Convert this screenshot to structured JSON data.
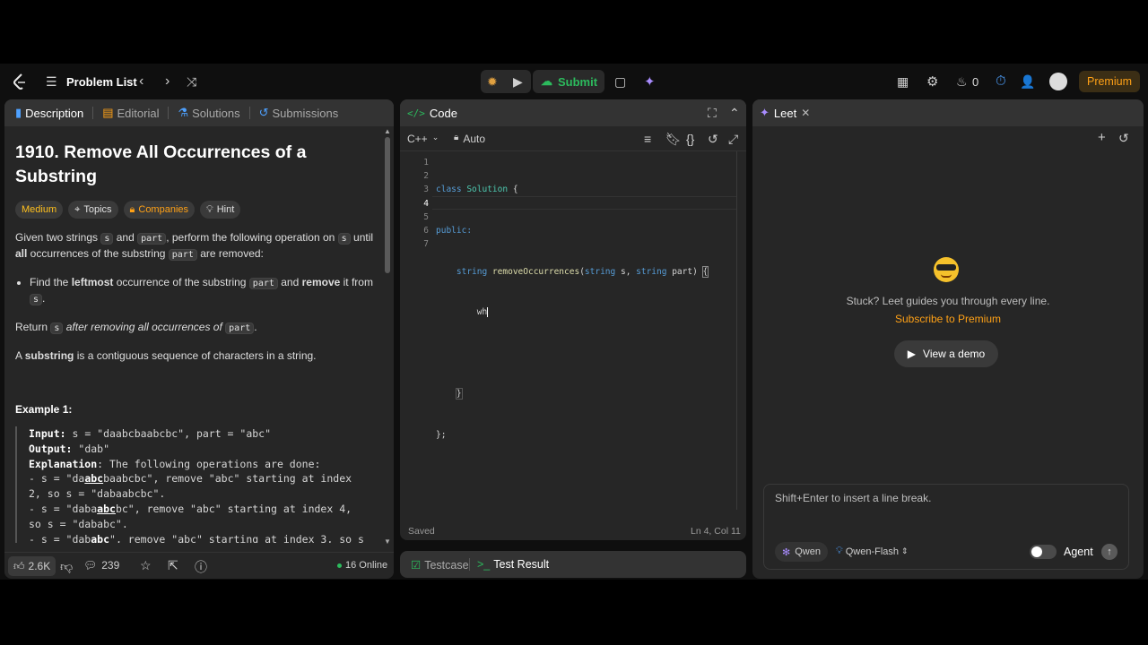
{
  "nav": {
    "problem_list": "Problem List",
    "submit": "Submit",
    "fire_count": "0",
    "premium": "Premium"
  },
  "left": {
    "tabs": [
      "Description",
      "Editorial",
      "Solutions",
      "Submissions"
    ],
    "title": "1910. Remove All Occurrences of a Substring",
    "tags": {
      "difficulty": "Medium",
      "topics": "Topics",
      "companies": "Companies",
      "hint": "Hint"
    },
    "p1": {
      "a": "Given two strings ",
      "s": "s",
      "b": " and ",
      "part": "part",
      "c": ", perform the following operation on ",
      "s2": "s",
      "d": " until ",
      "all": "all",
      "e": " occurrences of the substring ",
      "part2": "part",
      "f": " are removed:"
    },
    "li": {
      "a": "Find the ",
      "leftmost": "leftmost",
      "b": " occurrence of the substring ",
      "part": "part",
      "c": " and ",
      "remove": "remove",
      "d": " it from ",
      "s": "s",
      "e": "."
    },
    "p2": {
      "a": "Return ",
      "s": "s",
      "b": " after removing all occurrences of ",
      "part": "part",
      "c": "."
    },
    "p3": {
      "a": "A ",
      "substring": "substring",
      "b": " is a contiguous sequence of characters in a string."
    },
    "example_title": "Example 1:",
    "example": {
      "input_label": "Input:",
      "input": " s = \"daabcbaabcbc\", part = \"abc\"",
      "output_label": "Output:",
      "output": " \"dab\"",
      "expl_label": "Explanation",
      "expl": ": The following operations are done:",
      "l1a": "- s = \"da",
      "l1b": "abc",
      "l1c": "baabcbc\", remove \"abc\" starting at index",
      "l2": "2, so s = \"dabaabcbc\".",
      "l3a": "- s = \"daba",
      "l3b": "abc",
      "l3c": "bc\", remove \"abc\" starting at index 4,",
      "l4": "so s = \"dababc\".",
      "l5a": "- s = \"dab",
      "l5b": "abc",
      "l5c": "\", remove \"abc\" starting at index 3, so s"
    },
    "footer": {
      "likes": "2.6K",
      "comments": "239",
      "online": "16 Online"
    }
  },
  "code": {
    "title": "Code",
    "lang": "C++",
    "mode": "Auto",
    "lines": [
      "1",
      "2",
      "3",
      "4",
      "5",
      "6",
      "7"
    ],
    "c1a": "class",
    "c1b": " Solution ",
    "c1c": "{",
    "c2": "public:",
    "c3a": "string",
    "c3b": "removeOccurrences",
    "c3c": "(",
    "c3d": "string",
    "c3e": " s, ",
    "c3f": "string",
    "c3g": " part) ",
    "c3h": "{",
    "c4": "wh",
    "c6": "}",
    "c7": "};",
    "saved": "Saved",
    "cursor": "Ln 4, Col 11"
  },
  "bottom": {
    "testcase": "Testcase",
    "test_result": "Test Result"
  },
  "leet": {
    "title": "Leet",
    "stuck": "Stuck? Leet guides you through every line.",
    "subscribe": "Subscribe to Premium",
    "demo": "View a demo",
    "placeholder": "Shift+Enter to insert a line break.",
    "model_provider": "Qwen",
    "model": "Qwen-Flash",
    "agent": "Agent"
  }
}
